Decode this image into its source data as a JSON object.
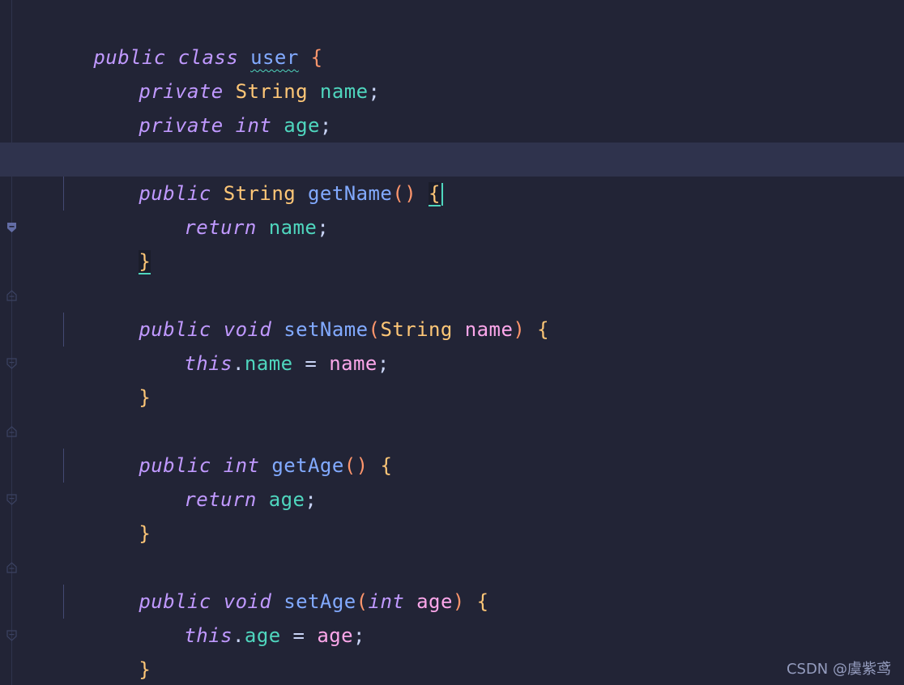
{
  "editor": {
    "tokens": {
      "public": "public",
      "private": "private",
      "class": "class",
      "int": "int",
      "void": "void",
      "return": "return",
      "this": "this",
      "String": "String",
      "class_name": "user",
      "field_name": "name",
      "field_age": "age",
      "fn_getName": "getName",
      "fn_setName": "setName",
      "fn_getAge": "getAge",
      "fn_setAge": "setAge",
      "open_paren": "(",
      "close_paren": ")",
      "empty_parens": "()",
      "open_brace": "{",
      "close_brace": "}",
      "semicolon": ";",
      "dot": ".",
      "assign": " = "
    },
    "colors": {
      "background": "#222436",
      "current_line": "#2f334d",
      "keyword": "#c099ff",
      "type": "#ffc777",
      "field": "#4fd6be",
      "function": "#82aaff",
      "parameter": "#fca7ea",
      "paren": "#ff966c"
    }
  },
  "watermark": "CSDN @虞紫鸢"
}
